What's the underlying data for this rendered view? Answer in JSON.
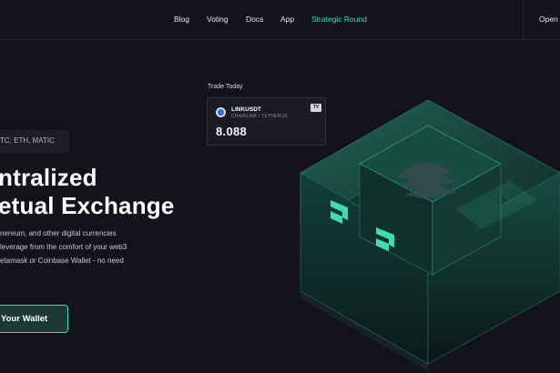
{
  "nav": {
    "links": [
      "Blog",
      "Voting",
      "Docs",
      "App"
    ],
    "highlight": "Strategic Round",
    "open_app_label": "Open"
  },
  "ticker": {
    "heading": "Trade Today",
    "pair": "LINKUSDT",
    "pair_names": "CHAINLINK / TETHERUS",
    "price": "8.088",
    "badge": "TV"
  },
  "hero": {
    "coins": "TC, ETH, MATIC",
    "headline_line1": "ntralized",
    "headline_line2": "etual Exchange",
    "desc_line1": "nereum, and other digital currencies",
    "desc_line2": "leverage from the comfort of your web3",
    "desc_line3": "etamask or Coinbase Wallet - no need",
    "cta_label": "Your Wallet"
  },
  "colors": {
    "background": "#13131b",
    "accent": "#3fdcb0",
    "card": "#1a1b24"
  },
  "icons": {
    "coin": "chainlink-coin-icon",
    "badge": "tradingview-logo-icon",
    "arrows": "chevron-arrow-icon"
  }
}
